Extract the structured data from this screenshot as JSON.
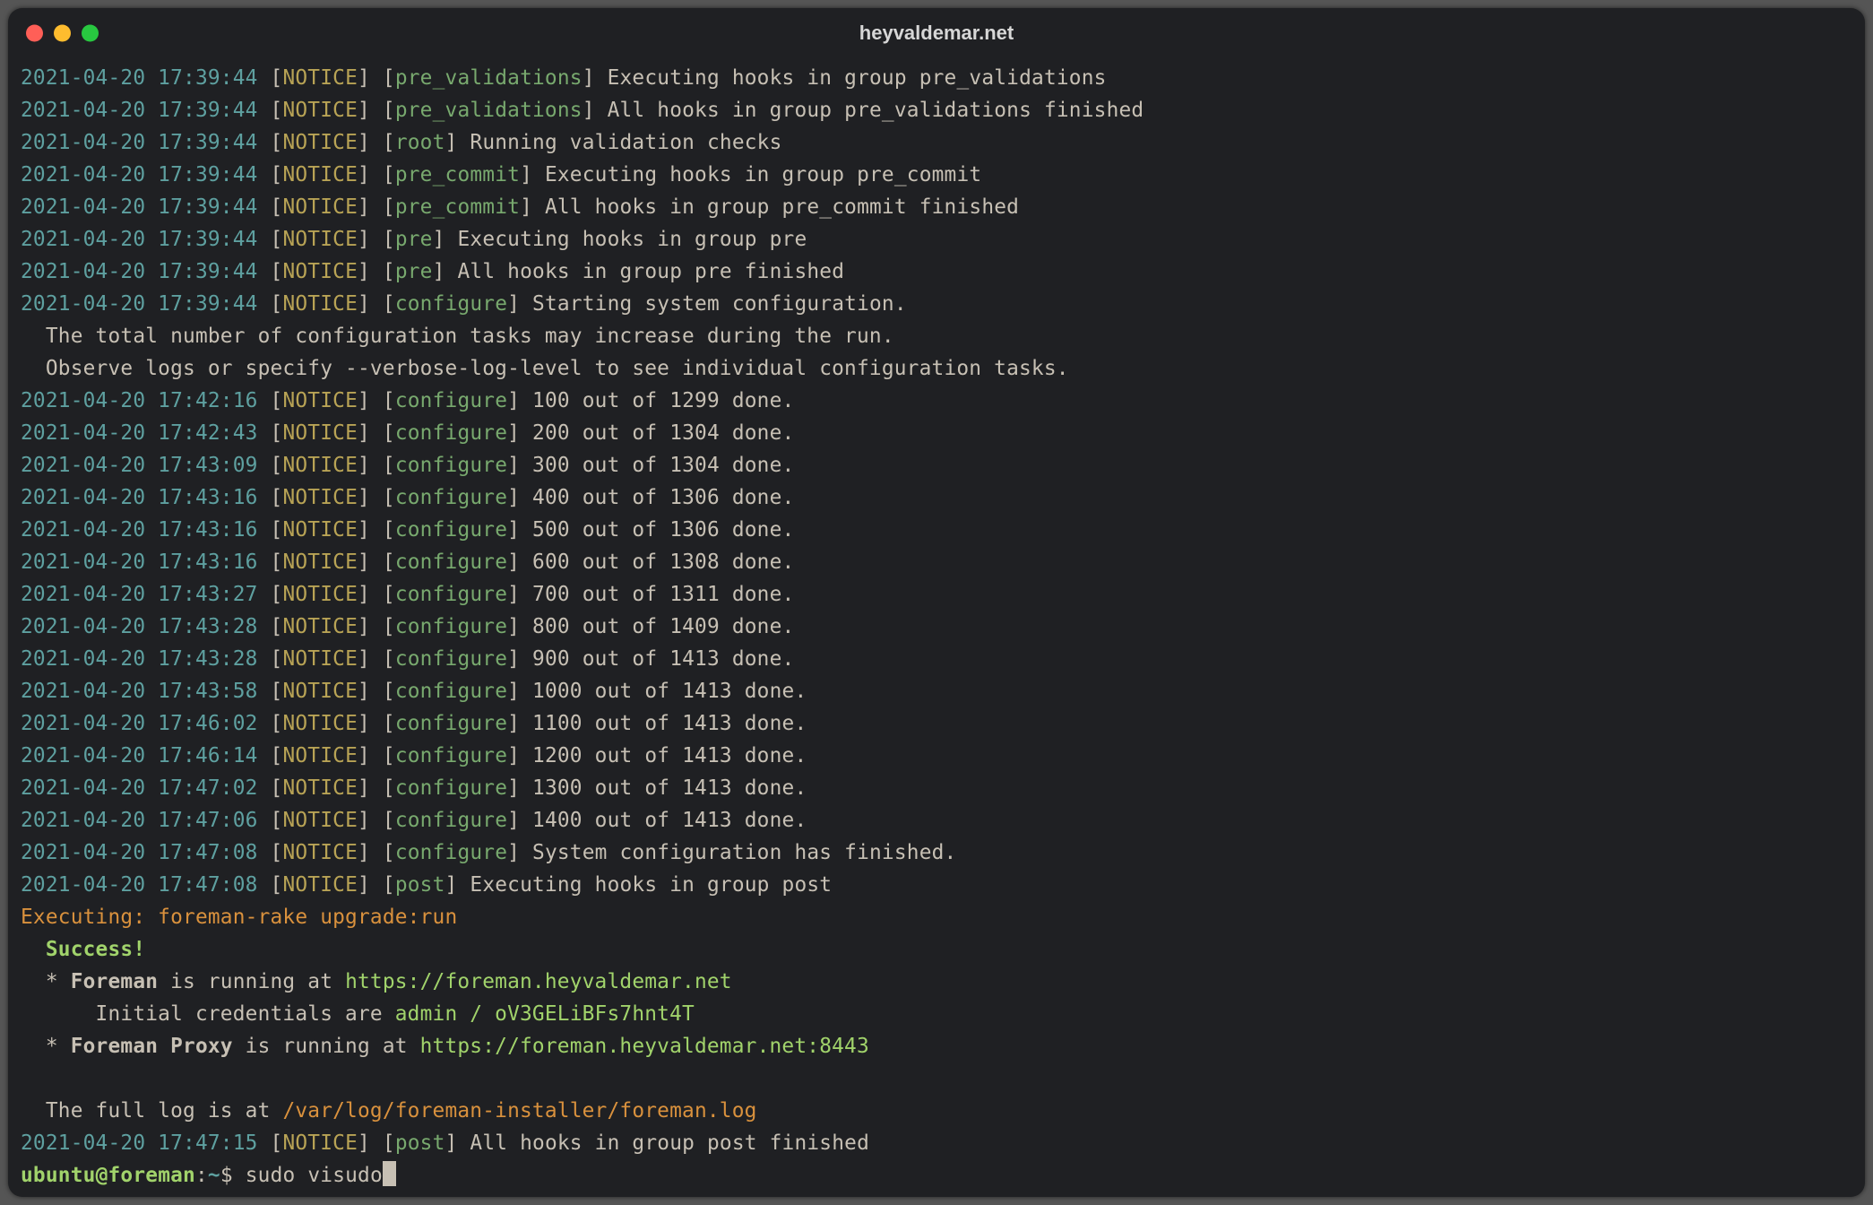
{
  "window": {
    "title": "heyvaldemar.net"
  },
  "colors": {
    "dot_red": "#ff5f57",
    "dot_yellow": "#febc2e",
    "dot_green": "#28c840",
    "bg": "#1f2023"
  },
  "log": [
    {
      "ts": "2021-04-20 17:39:44",
      "lvl": "NOTICE",
      "tag": "pre_validations",
      "msg": "Executing hooks in group pre_validations"
    },
    {
      "ts": "2021-04-20 17:39:44",
      "lvl": "NOTICE",
      "tag": "pre_validations",
      "msg": "All hooks in group pre_validations finished"
    },
    {
      "ts": "2021-04-20 17:39:44",
      "lvl": "NOTICE",
      "tag": "root",
      "msg": "Running validation checks"
    },
    {
      "ts": "2021-04-20 17:39:44",
      "lvl": "NOTICE",
      "tag": "pre_commit",
      "msg": "Executing hooks in group pre_commit"
    },
    {
      "ts": "2021-04-20 17:39:44",
      "lvl": "NOTICE",
      "tag": "pre_commit",
      "msg": "All hooks in group pre_commit finished"
    },
    {
      "ts": "2021-04-20 17:39:44",
      "lvl": "NOTICE",
      "tag": "pre",
      "msg": "Executing hooks in group pre"
    },
    {
      "ts": "2021-04-20 17:39:44",
      "lvl": "NOTICE",
      "tag": "pre",
      "msg": "All hooks in group pre finished"
    },
    {
      "ts": "2021-04-20 17:39:44",
      "lvl": "NOTICE",
      "tag": "configure",
      "msg": "Starting system configuration."
    }
  ],
  "notes": [
    "  The total number of configuration tasks may increase during the run.",
    "  Observe logs or specify --verbose-log-level to see individual configuration tasks."
  ],
  "progress": [
    {
      "ts": "2021-04-20 17:42:16",
      "lvl": "NOTICE",
      "tag": "configure",
      "msg": "100 out of 1299 done."
    },
    {
      "ts": "2021-04-20 17:42:43",
      "lvl": "NOTICE",
      "tag": "configure",
      "msg": "200 out of 1304 done."
    },
    {
      "ts": "2021-04-20 17:43:09",
      "lvl": "NOTICE",
      "tag": "configure",
      "msg": "300 out of 1304 done."
    },
    {
      "ts": "2021-04-20 17:43:16",
      "lvl": "NOTICE",
      "tag": "configure",
      "msg": "400 out of 1306 done."
    },
    {
      "ts": "2021-04-20 17:43:16",
      "lvl": "NOTICE",
      "tag": "configure",
      "msg": "500 out of 1306 done."
    },
    {
      "ts": "2021-04-20 17:43:16",
      "lvl": "NOTICE",
      "tag": "configure",
      "msg": "600 out of 1308 done."
    },
    {
      "ts": "2021-04-20 17:43:27",
      "lvl": "NOTICE",
      "tag": "configure",
      "msg": "700 out of 1311 done."
    },
    {
      "ts": "2021-04-20 17:43:28",
      "lvl": "NOTICE",
      "tag": "configure",
      "msg": "800 out of 1409 done."
    },
    {
      "ts": "2021-04-20 17:43:28",
      "lvl": "NOTICE",
      "tag": "configure",
      "msg": "900 out of 1413 done."
    },
    {
      "ts": "2021-04-20 17:43:58",
      "lvl": "NOTICE",
      "tag": "configure",
      "msg": "1000 out of 1413 done."
    },
    {
      "ts": "2021-04-20 17:46:02",
      "lvl": "NOTICE",
      "tag": "configure",
      "msg": "1100 out of 1413 done."
    },
    {
      "ts": "2021-04-20 17:46:14",
      "lvl": "NOTICE",
      "tag": "configure",
      "msg": "1200 out of 1413 done."
    },
    {
      "ts": "2021-04-20 17:47:02",
      "lvl": "NOTICE",
      "tag": "configure",
      "msg": "1300 out of 1413 done."
    },
    {
      "ts": "2021-04-20 17:47:06",
      "lvl": "NOTICE",
      "tag": "configure",
      "msg": "1400 out of 1413 done."
    },
    {
      "ts": "2021-04-20 17:47:08",
      "lvl": "NOTICE",
      "tag": "configure",
      "msg": "System configuration has finished."
    },
    {
      "ts": "2021-04-20 17:47:08",
      "lvl": "NOTICE",
      "tag": "post",
      "msg": "Executing hooks in group post"
    }
  ],
  "exec_line": "Executing: foreman-rake upgrade:run",
  "success_label": "  Success!",
  "services": [
    {
      "bullet": "  * ",
      "name": "Foreman",
      "between": " is running at ",
      "url": "https://foreman.heyvaldemar.net"
    },
    {
      "indent": "      ",
      "pre": "Initial credentials are ",
      "cred": "admin / oV3GELiBFs7hnt4T"
    },
    {
      "bullet": "  * ",
      "name": "Foreman Proxy",
      "between": " is running at ",
      "url": "https://foreman.heyvaldemar.net:8443"
    }
  ],
  "log_path": {
    "pre": "  The full log is at ",
    "path": "/var/log/foreman-installer/foreman.log"
  },
  "final_log": {
    "ts": "2021-04-20 17:47:15",
    "lvl": "NOTICE",
    "tag": "post",
    "msg": "All hooks in group post finished"
  },
  "prompt": {
    "user": "ubuntu",
    "at": "@",
    "host": "foreman",
    "colon": ":",
    "path": "~",
    "sym": "$ ",
    "cmd": "sudo visudo"
  }
}
